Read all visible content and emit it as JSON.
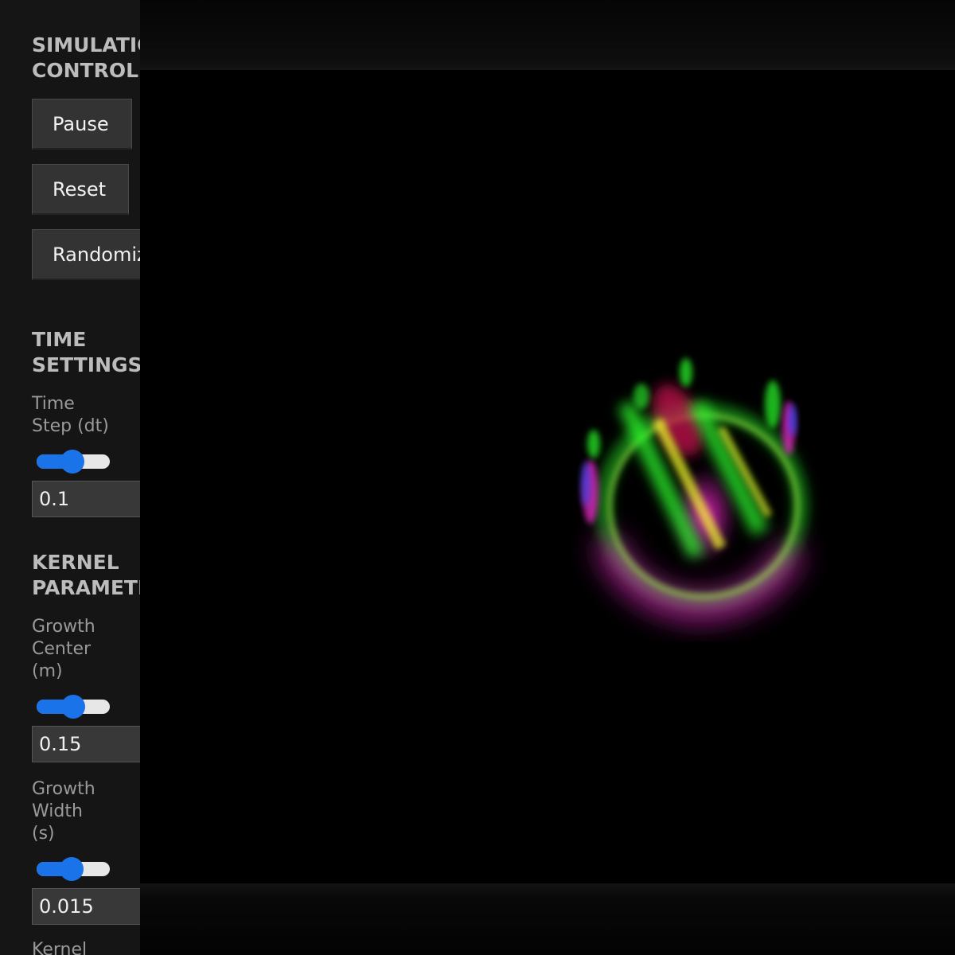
{
  "sidebar": {
    "simulation_control": {
      "title": "SIMULATION\nCONTROL",
      "pause_label": "Pause",
      "reset_label": "Reset",
      "randomize_label": "Randomize"
    },
    "time_settings": {
      "title": "TIME\nSETTINGS",
      "time_step": {
        "label": "Time\nStep (dt)",
        "value": "0.1",
        "slider_fraction": 0.5
      }
    },
    "kernel_parameters": {
      "title": "KERNEL\nPARAMETERS",
      "growth_center": {
        "label": "Growth\nCenter\n(m)",
        "value": "0.15",
        "slider_fraction": 0.5
      },
      "growth_width": {
        "label": "Growth\nWidth\n(s)",
        "value": "0.015",
        "slider_fraction": 0.48
      },
      "kernel_label": "Kernel"
    }
  },
  "colors": {
    "accent": "#1a73e8",
    "sidebar_bg": "#151515",
    "organism_magenta": "#ff2bd8",
    "organism_green": "#2bff2b",
    "organism_yellow": "#f5ff2b",
    "organism_blue": "#2b4bff"
  }
}
